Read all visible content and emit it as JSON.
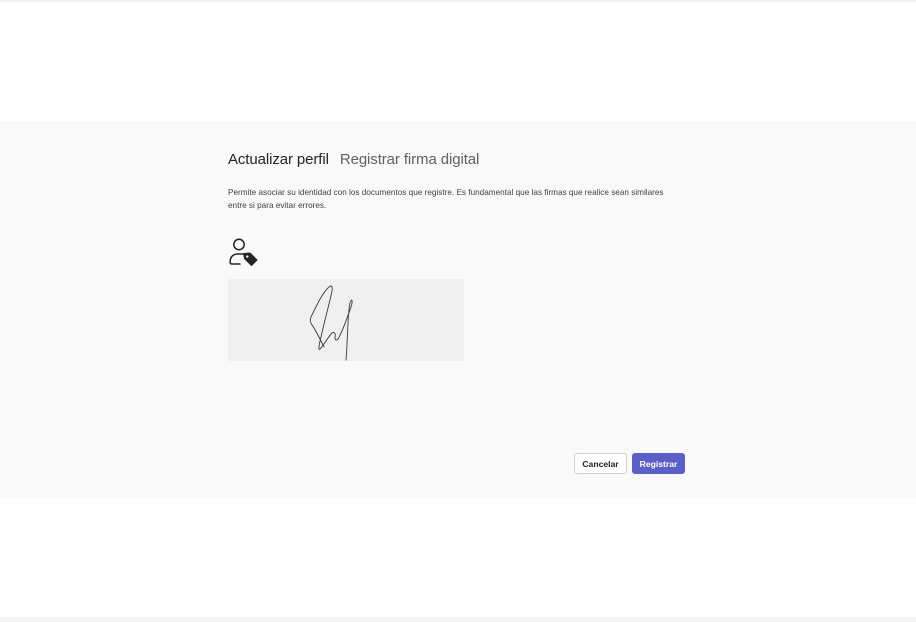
{
  "header": {
    "title": "Actualizar perfil",
    "subtitle": "Registrar firma digital"
  },
  "description": "Permite asociar su identidad con los documentos que registre. Es fundamental que las firmas que realice sean similares entre si para evitar errores.",
  "icons": {
    "identity": "person-tag-icon"
  },
  "actions": {
    "cancel_label": "Cancelar",
    "submit_label": "Registrar"
  },
  "colors": {
    "primary": "#5b5fc7",
    "panel_background": "#f9f9f9",
    "signature_pad_background": "#f0f0f0"
  }
}
